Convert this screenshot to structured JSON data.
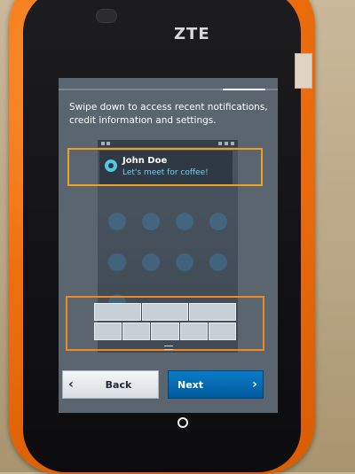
{
  "device": {
    "brand": "ZTE"
  },
  "onboarding": {
    "progress_fraction": 0.8,
    "instruction_line1": "Swipe down to access recent notifications,",
    "instruction_line2": "credit information and settings."
  },
  "notification": {
    "sender": "John Doe",
    "message": "Let's meet for coffee!"
  },
  "buttons": {
    "back_label": "Back",
    "next_label": "Next",
    "back_icon": "chevron-left-icon",
    "next_icon": "chevron-right-icon"
  },
  "colors": {
    "highlight": "#f0a020",
    "next_button": "#0a7cc9",
    "notification_accent": "#55c7e6"
  }
}
